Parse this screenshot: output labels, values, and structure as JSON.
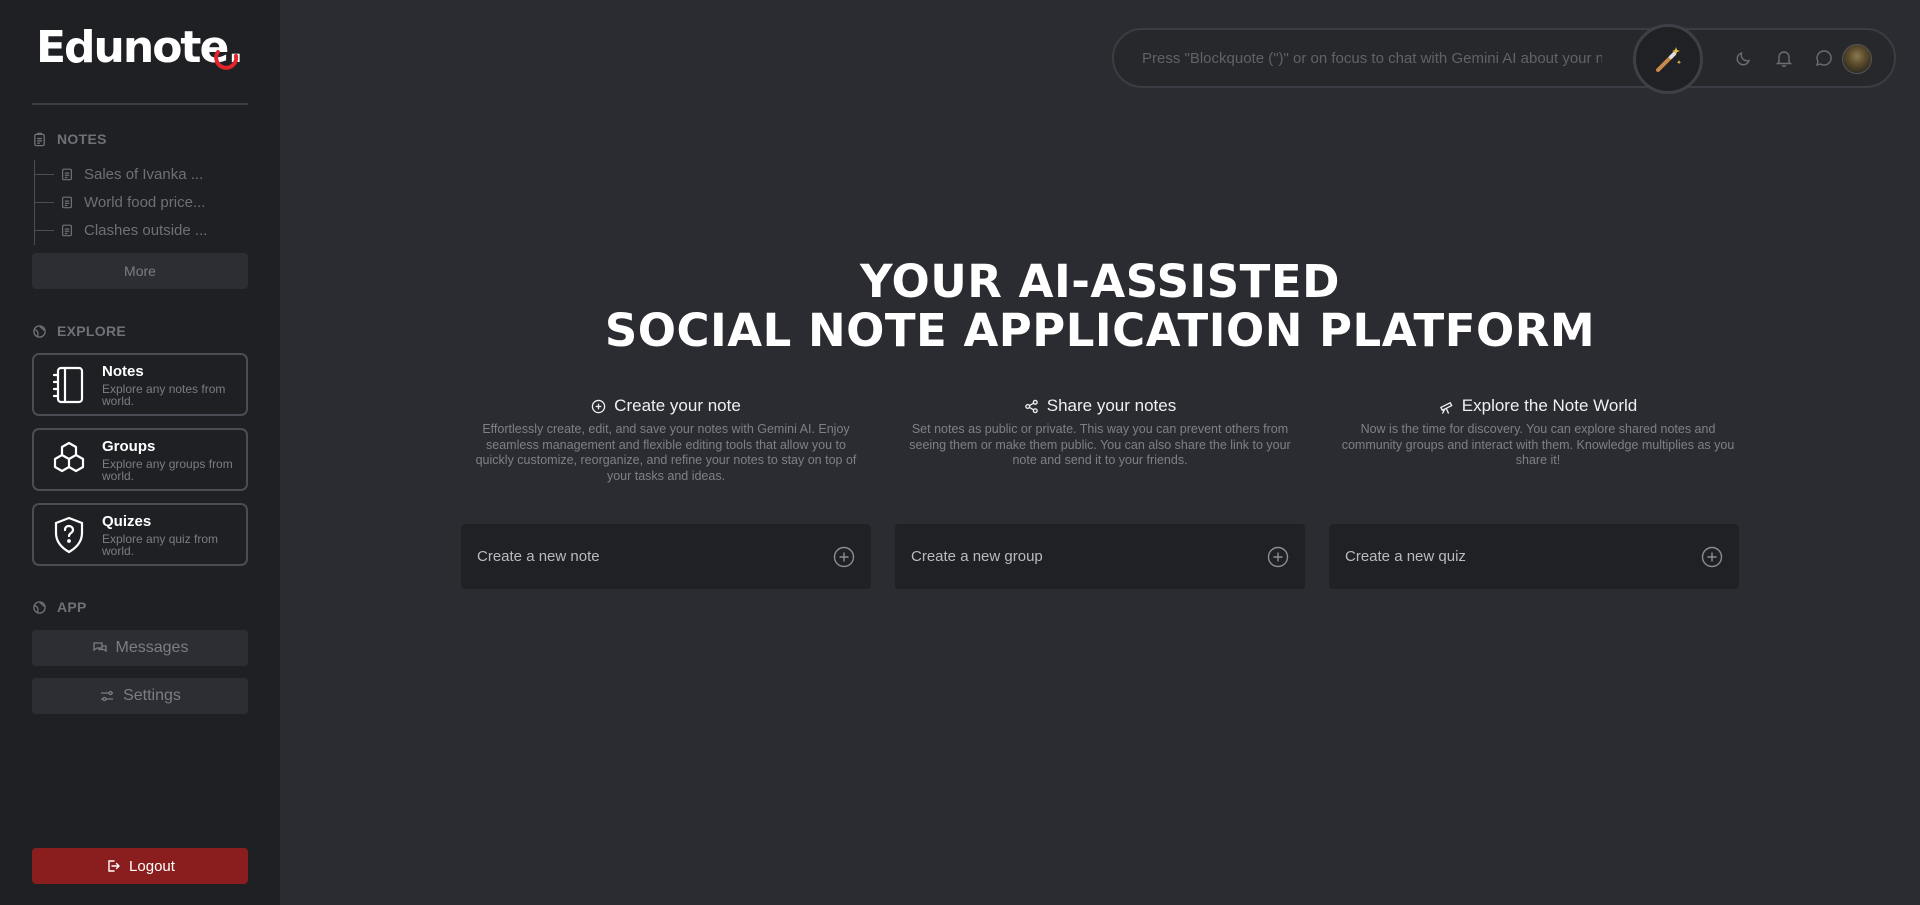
{
  "brand": {
    "name": "Edunote"
  },
  "sidebar": {
    "notes_heading": "NOTES",
    "recent_notes": [
      "Sales of Ivanka ...",
      "World food price...",
      "Clashes outside ..."
    ],
    "more_label": "More",
    "explore_heading": "EXPLORE",
    "explore_cards": [
      {
        "title": "Notes",
        "desc": "Explore any notes from world.",
        "icon": "notebook-icon"
      },
      {
        "title": "Groups",
        "desc": "Explore any groups from world.",
        "icon": "cubes-icon"
      },
      {
        "title": "Quizes",
        "desc": "Explore any quiz from world.",
        "icon": "shield-question-icon"
      }
    ],
    "app_heading": "APP",
    "messages_label": "Messages",
    "settings_label": "Settings",
    "logout_label": "Logout"
  },
  "topbar": {
    "search_placeholder": "Press \"Blockquote (\")\" or on focus to chat with Gemini AI about your notes",
    "icons": [
      "magic-wand-icon",
      "moon-icon",
      "bell-icon",
      "chat-icon",
      "avatar"
    ]
  },
  "hero": {
    "line1": "YOUR AI-ASSISTED",
    "line2": "SOCIAL NOTE APPLICATION PLATFORM"
  },
  "features": [
    {
      "title": "Create your note",
      "icon": "plus-circle-icon",
      "text": "Effortlessly create, edit, and save your notes with Gemini AI. Enjoy seamless management and flexible editing tools that allow you to quickly customize, reorganize, and refine your notes to stay on top of your tasks and ideas."
    },
    {
      "title": "Share your notes",
      "icon": "share-icon",
      "text": "Set notes as public or private. This way you can prevent others from seeing them or make them public. You can also share the link to your note and send it to your friends."
    },
    {
      "title": "Explore the Note World",
      "icon": "telescope-icon",
      "text": "Now is the time for discovery. You can explore shared notes and community groups and interact with them. Knowledge multiplies as you share it!"
    }
  ],
  "actions": [
    {
      "label": "Create a new note"
    },
    {
      "label": "Create a new group"
    },
    {
      "label": "Create a new quiz"
    }
  ],
  "colors": {
    "background": "#2a2c31",
    "sidebar": "#1e2024",
    "logout": "#8a1e1e",
    "brand_accent": "#e0262a"
  }
}
